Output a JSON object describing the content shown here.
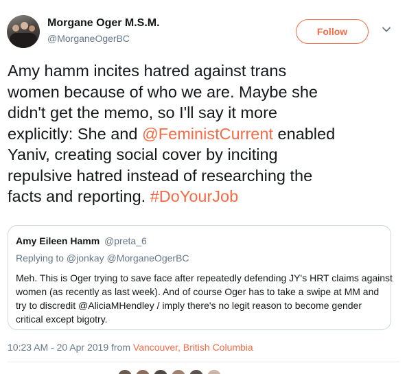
{
  "author": {
    "display_name": "Morgane Oger M.S.M.",
    "handle": "@MorganeOgerBC"
  },
  "follow_label": "Follow",
  "tweet": {
    "lines": [
      {
        "text": "Amy hamm incites hatred against trans"
      },
      {
        "text": "women because of who we are. Maybe she"
      },
      {
        "text": "didn't get the memo, so I'll say it more"
      },
      {
        "pre": "explicitly:  She and ",
        "link": "@FeministCurrent",
        "post": " enabled"
      },
      {
        "text": "Yaniv, creating social cover by inciting"
      },
      {
        "text": "repulsive hatred instead of researching the"
      },
      {
        "pre": "facts and reporting. ",
        "link": "#DoYourJob",
        "post": ""
      }
    ]
  },
  "quoted": {
    "name": "Amy Eileen Hamm",
    "handle": "@preta_6",
    "replying_to": "Replying to @jonkay @MorganeOgerBC",
    "lines": [
      "Meh. This is Oger trying to save face after repeatedly defending JY's HRT claims against",
      "women (as recently as last week). And of course Oger has to take a swipe at MM and",
      "try to discredit @AliciaMHendley / imply there's no legit reason to become gender",
      "critical except bigotry."
    ]
  },
  "meta": {
    "time": "10:23 AM - 20 Apr 2019",
    "from": " from ",
    "location": "Vancouver, British Columbia"
  },
  "colors": {
    "accent": "#f46b46",
    "secondary_text": "#657786",
    "border": "#ccd6dd"
  },
  "icons": {
    "caret": "chevron-down-icon"
  }
}
